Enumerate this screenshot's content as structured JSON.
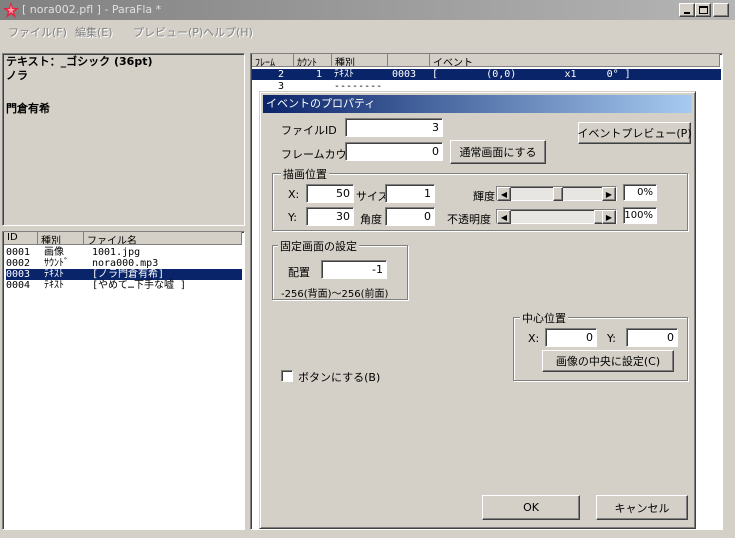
{
  "window": {
    "title": "[ nora002.pfl ] - ParaFla *",
    "min_icon": "minimize-icon",
    "max_icon": "maximize-icon",
    "close_icon": "close-icon"
  },
  "menu": [
    "ファイル(F)",
    "編集(E)",
    "プレビュー(P)",
    "ヘルプ(H)"
  ],
  "preview": {
    "font_line": "テキスト：_ゴシック (36pt)",
    "text_line1": "ノラ",
    "text_line2": "門倉有希"
  },
  "file_list": {
    "headers": [
      "ID",
      "種別",
      "ファイル名"
    ],
    "rows": [
      {
        "id": "0001",
        "type": "画像",
        "name": "1001.jpg"
      },
      {
        "id": "0002",
        "type": "ｻｳﾝﾄﾞ",
        "name": "nora000.mp3"
      },
      {
        "id": "0003",
        "type": "ﾃｷｽﾄ",
        "name": "[ノラ門倉有希]"
      },
      {
        "id": "0004",
        "type": "ﾃｷｽﾄ",
        "name": "[やめて…下手な嘘 ]"
      }
    ],
    "selected_index": 2
  },
  "event_list": {
    "headers": [
      "ﾌﾚｰﾑ",
      "ｶｳﾝﾄ",
      "種別",
      "",
      "イベント"
    ],
    "row1": {
      "frame": "2",
      "count": "1",
      "type": "ﾃｷｽﾄ",
      "id": "0003",
      "event": "[        (0,0)        x1     0° ]"
    },
    "row2": {
      "frame": "3",
      "count": "",
      "type": "--------"
    }
  },
  "dialog": {
    "title": "イベントのプロパティ",
    "file_id_label": "ファイルID",
    "file_id_value": "3",
    "frame_count_label": "フレームカウント",
    "frame_count_value": "0",
    "normal_screen_button": "通常画面にする",
    "event_preview_button": "イベントプレビュー(P)",
    "draw_position": {
      "label": "描画位置",
      "x_label": "X:",
      "x_value": "50",
      "y_label": "Y:",
      "y_value": "30",
      "size_label": "サイズ",
      "size_value": "1",
      "angle_label": "角度",
      "angle_value": "0",
      "brightness_label": "輝度",
      "brightness_value": "0%",
      "brightness_level": 0.5,
      "opacity_label": "不透明度",
      "opacity_value": "100%",
      "opacity_level": 1.0
    },
    "fixed_screen": {
      "label": "固定画面の設定",
      "place_label": "配置",
      "place_value": "-1",
      "range_text": "-256(背面)～256(前面)"
    },
    "center": {
      "label": "中心位置",
      "x_label": "X:",
      "x_value": "0",
      "y_label": "Y:",
      "y_value": "0",
      "center_button": "画像の中央に設定(C)"
    },
    "button_checkbox_label": "ボタンにする(B)",
    "ok_button": "OK",
    "cancel_button": "キャンセル"
  }
}
